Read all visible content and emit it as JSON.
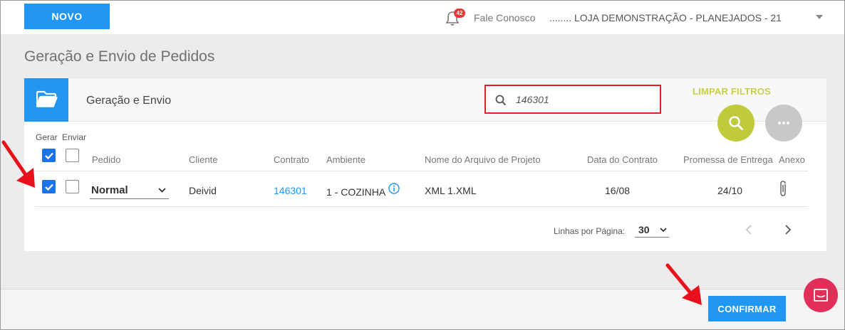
{
  "topbar": {
    "new_button": "NOVO",
    "notifications_count": "42",
    "contact_link": "Fale Conosco",
    "store_selector": "........ LOJA DEMONSTRAÇÃO - PLANEJADOS - 21"
  },
  "page": {
    "title": "Geração e Envio de Pedidos"
  },
  "card": {
    "title": "Geração e Envio",
    "search": {
      "value": "146301",
      "placeholder": ""
    },
    "clear_filters": "LIMPAR FILTROS"
  },
  "table": {
    "group_labels": {
      "gerar": "Gerar",
      "enviar": "Enviar"
    },
    "columns": {
      "pedido": "Pedido",
      "cliente": "Cliente",
      "contrato": "Contrato",
      "ambiente": "Ambiente",
      "arquivo": "Nome do Arquivo de Projeto",
      "data_contrato": "Data do Contrato",
      "promessa": "Promessa de Entrega",
      "anexo": "Anexo"
    },
    "header_checks": {
      "gerar": true,
      "enviar": false
    },
    "rows": [
      {
        "gerar": true,
        "enviar": false,
        "pedido": "Normal",
        "cliente": "Deivid",
        "contrato": "146301",
        "ambiente": "1 - COZINHA",
        "arquivo": "XML 1.XML",
        "data_contrato": "16/08",
        "promessa": "24/10"
      }
    ]
  },
  "pagination": {
    "label": "Linhas por Página:",
    "rows_per_page": "30"
  },
  "footer": {
    "confirm_button": "CONFIRMAR"
  },
  "colors": {
    "primary": "#2196f3",
    "search_highlight": "#e0202a",
    "accent_lime": "#bfcb3a",
    "annotation_arrow": "#e8101a",
    "chat": "#e0305a"
  },
  "icons": [
    "bell-icon",
    "chevron-down-icon",
    "folder-icon",
    "search-icon",
    "more-icon",
    "checkmark-icon",
    "info-icon",
    "paperclip-icon",
    "chevron-left-icon",
    "chevron-right-icon",
    "chat-icon",
    "arrow-icon"
  ]
}
